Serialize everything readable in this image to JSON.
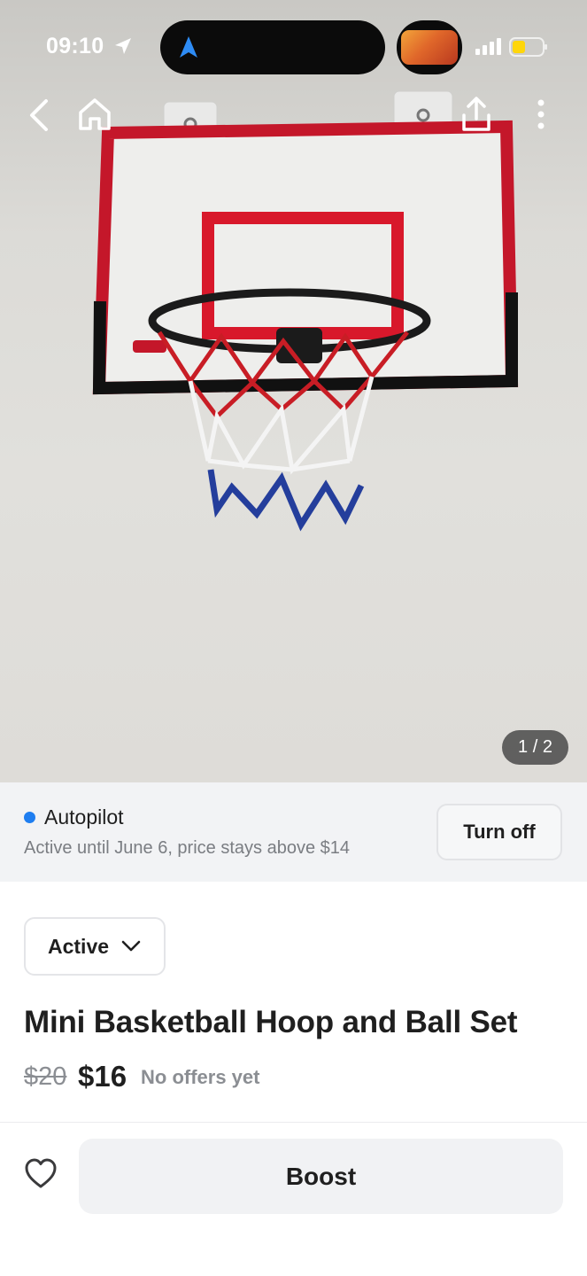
{
  "status_bar": {
    "time": "09:10",
    "icons": [
      "location-arrow-icon",
      "navigation-icon",
      "signal-icon",
      "battery-icon"
    ]
  },
  "top_nav": {
    "icons": [
      "chevron-left-icon",
      "home-icon",
      "share-icon",
      "more-vertical-icon"
    ]
  },
  "gallery": {
    "counter": "1 / 2"
  },
  "autopilot": {
    "title": "Autopilot",
    "subtitle": "Active until June 6, price stays above $14",
    "button": "Turn off",
    "dot_color": "#1f7ef0"
  },
  "listing": {
    "status": "Active",
    "title": "Mini Basketball Hoop and Ball Set",
    "old_price": "$20",
    "price": "$16",
    "offers": "No offers yet"
  },
  "bottom": {
    "boost": "Boost"
  },
  "colors": {
    "accent_blue": "#1f7ef0",
    "muted_text": "#7a7d82",
    "panel_bg": "#f2f3f5"
  }
}
